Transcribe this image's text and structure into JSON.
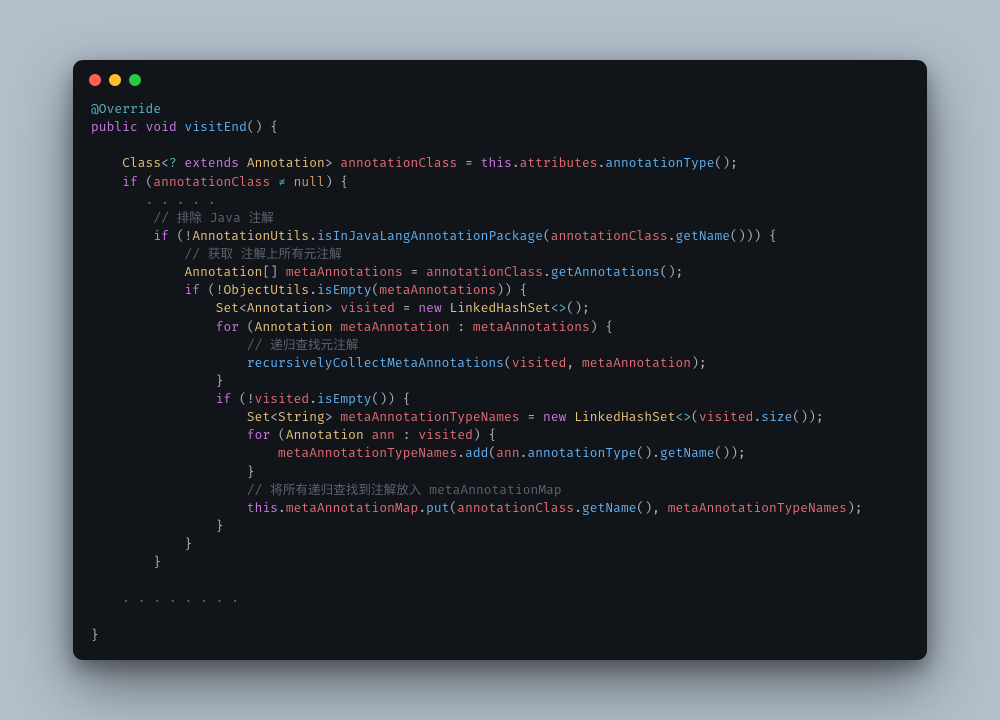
{
  "window": {
    "buttons": {
      "close_color": "#ff5f57",
      "minimize_color": "#febc2e",
      "maximize_color": "#28c840"
    }
  },
  "code": {
    "annotation": "@Override",
    "kw_public": "public",
    "kw_void": "void",
    "fn_visitEnd": "visitEnd",
    "type_Class": "Class",
    "kw_extends": "extends",
    "type_Annotation": "Annotation",
    "var_annotationClass": "annotationClass",
    "kw_this": "this",
    "prop_attributes": "attributes",
    "fn_annotationType": "annotationType",
    "kw_if": "if",
    "op_neq": "≠",
    "kw_null": "null",
    "ellipsis5": ". . . . .",
    "comm_excludeJava": "// 排除 Java 注解",
    "type_AnnotationUtils": "AnnotationUtils",
    "fn_isInJavaLangAnnotationPackage": "isInJavaLangAnnotationPackage",
    "fn_getName": "getName",
    "comm_getAllMeta": "// 获取 注解上所有元注解",
    "var_metaAnnotations": "metaAnnotations",
    "fn_getAnnotations": "getAnnotations",
    "type_ObjectUtils": "ObjectUtils",
    "fn_isEmpty": "isEmpty",
    "type_Set": "Set",
    "var_visited": "visited",
    "kw_new": "new",
    "type_LinkedHashSet": "LinkedHashSet",
    "op_diamond": "<>",
    "kw_for": "for",
    "var_metaAnnotation": "metaAnnotation",
    "comm_recurseMeta": "// 递归查找元注解",
    "fn_recursivelyCollectMetaAnnotations": "recursivelyCollectMetaAnnotations",
    "type_String": "String",
    "var_metaAnnotationTypeNames": "metaAnnotationTypeNames",
    "fn_size": "size",
    "var_ann": "ann",
    "fn_add": "add",
    "comm_putAllFound": "// 将所有递归查找到注解放入 metaAnnotationMap",
    "prop_metaAnnotationMap": "metaAnnotationMap",
    "fn_put": "put",
    "ellipsis8": ". . . . . . . ."
  }
}
